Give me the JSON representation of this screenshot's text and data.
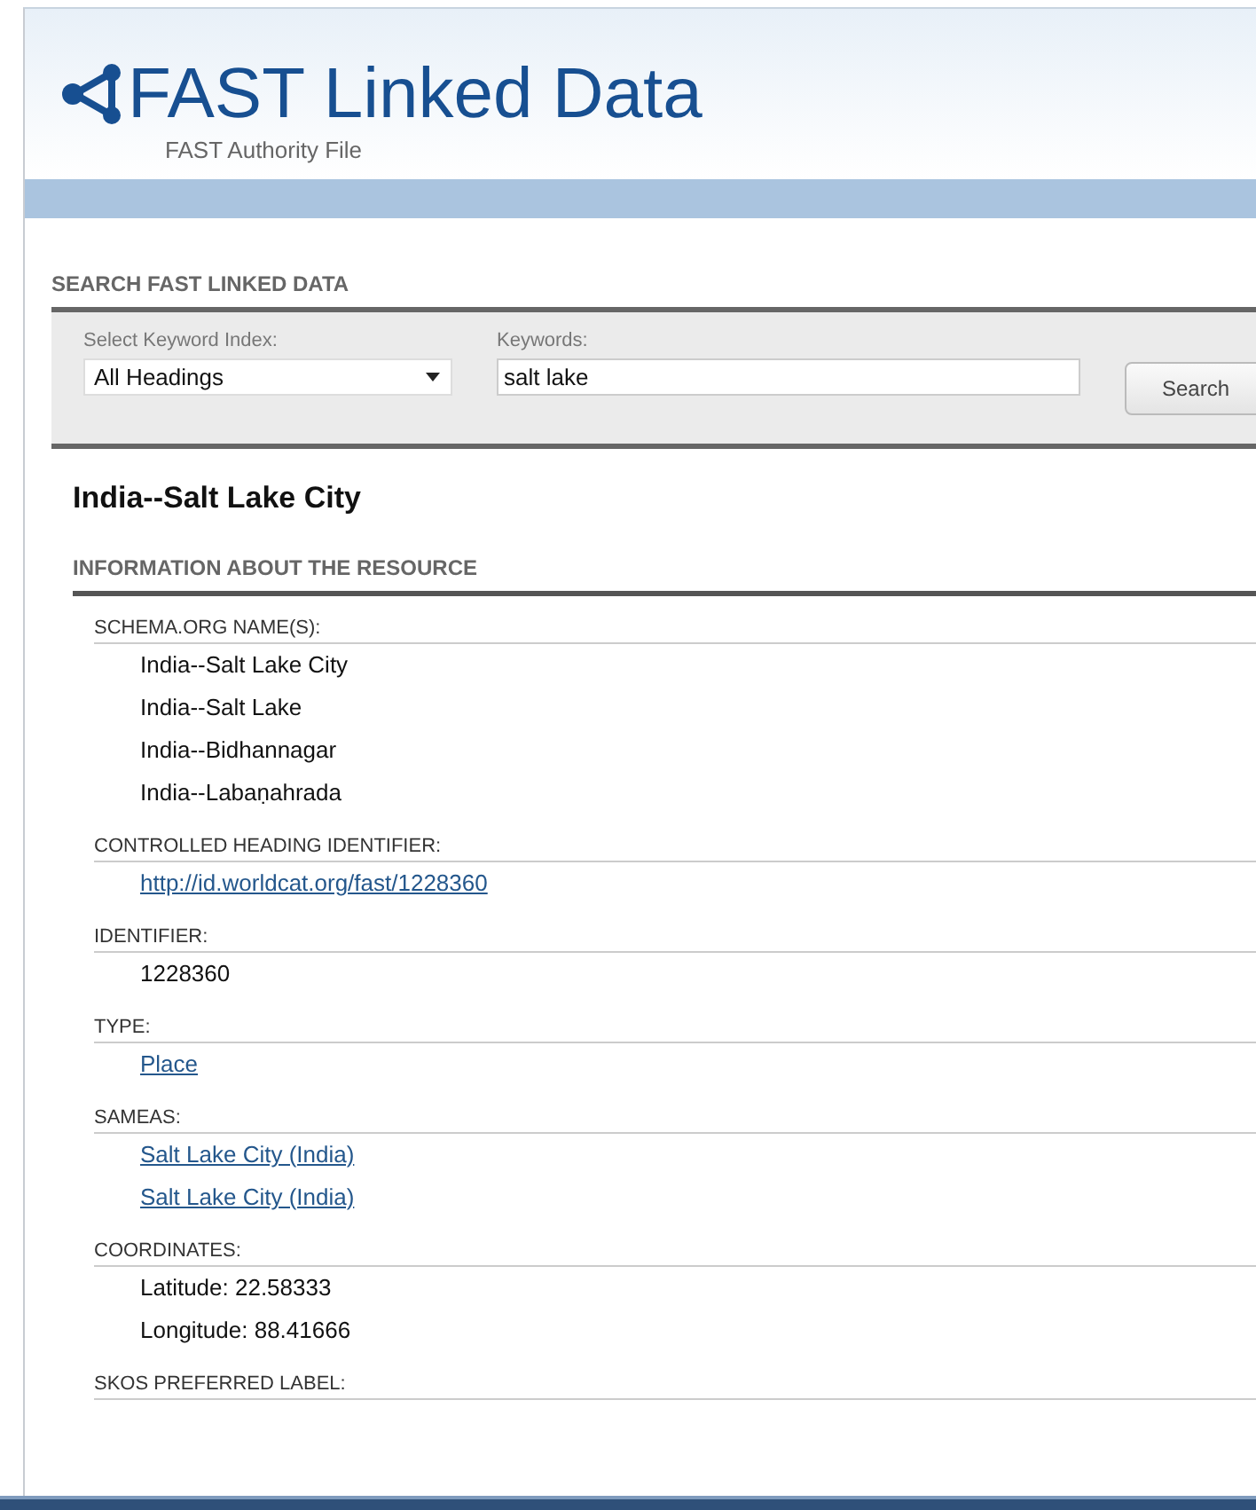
{
  "header": {
    "title": "FAST Linked Data",
    "subtitle": "FAST Authority File"
  },
  "search": {
    "heading": "SEARCH FAST LINKED DATA",
    "index_label": "Select Keyword Index:",
    "index_value": "All Headings",
    "keywords_label": "Keywords:",
    "keywords_value": "salt lake",
    "button": "Search"
  },
  "record": {
    "title": "India--Salt Lake City",
    "section": "INFORMATION ABOUT THE RESOURCE",
    "fields": [
      {
        "label": "SCHEMA.ORG NAME(S):",
        "values": [
          {
            "kind": "text",
            "text": "India--Salt Lake City"
          },
          {
            "kind": "text",
            "text": "India--Salt Lake"
          },
          {
            "kind": "text",
            "text": "India--Bidhannagar"
          },
          {
            "kind": "text",
            "text": "India--Labaṇahrada"
          }
        ]
      },
      {
        "label": "CONTROLLED HEADING IDENTIFIER:",
        "values": [
          {
            "kind": "link",
            "text": "http://id.worldcat.org/fast/1228360"
          }
        ]
      },
      {
        "label": "IDENTIFIER:",
        "values": [
          {
            "kind": "text",
            "text": "1228360"
          }
        ]
      },
      {
        "label": "TYPE:",
        "values": [
          {
            "kind": "link",
            "text": "Place"
          }
        ]
      },
      {
        "label": "SAMEAS:",
        "values": [
          {
            "kind": "link",
            "text": "Salt Lake City (India)"
          },
          {
            "kind": "link",
            "text": "Salt Lake City (India)"
          }
        ]
      },
      {
        "label": "COORDINATES:",
        "values": [
          {
            "kind": "text",
            "text": "Latitude: 22.58333"
          },
          {
            "kind": "text",
            "text": "Longitude: 88.41666"
          }
        ]
      },
      {
        "label": "SKOS PREFERRED LABEL:"
      }
    ]
  }
}
